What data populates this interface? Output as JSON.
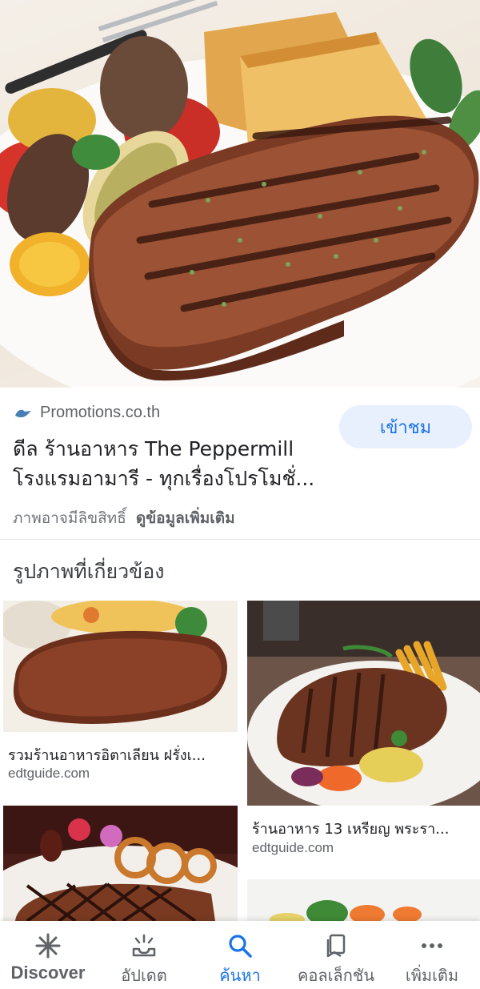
{
  "result": {
    "source": "Promotions.co.th",
    "visit_label": "เข้าชม",
    "title_line1": "ดีล ร้านอาหาร The Peppermill",
    "title_line2": "โรงแรมอามารี - ทุกเรื่องโปรโมชั่...",
    "notice": "ภาพอาจมีลิขสิทธิ์",
    "learn_more": "ดูข้อมูลเพิ่มเติม"
  },
  "related": {
    "heading": "รูปภาพที่เกี่ยวข้อง",
    "items": [
      {
        "caption": "รวมร้านอาหารอิตาเลียน ฝรั่งเ...",
        "source": "edtguide.com"
      },
      {
        "caption": "ร้านอาหาร 13 เหรียญ พระรา...",
        "source": "edtguide.com"
      },
      {
        "caption": "",
        "source": ""
      },
      {
        "caption": "",
        "source": ""
      }
    ]
  },
  "bottom_nav": {
    "items": [
      {
        "label": "Discover",
        "icon": "asterisk-icon"
      },
      {
        "label": "อัปเดต",
        "icon": "updates-icon"
      },
      {
        "label": "ค้นหา",
        "icon": "search-icon"
      },
      {
        "label": "คอลเล็กชัน",
        "icon": "bookmark-icon"
      },
      {
        "label": "เพิ่มเติม",
        "icon": "more-icon"
      }
    ],
    "active": "ค้นหา"
  },
  "colors": {
    "accent": "#1a73e8",
    "visit_bg": "#e8f0fe"
  }
}
